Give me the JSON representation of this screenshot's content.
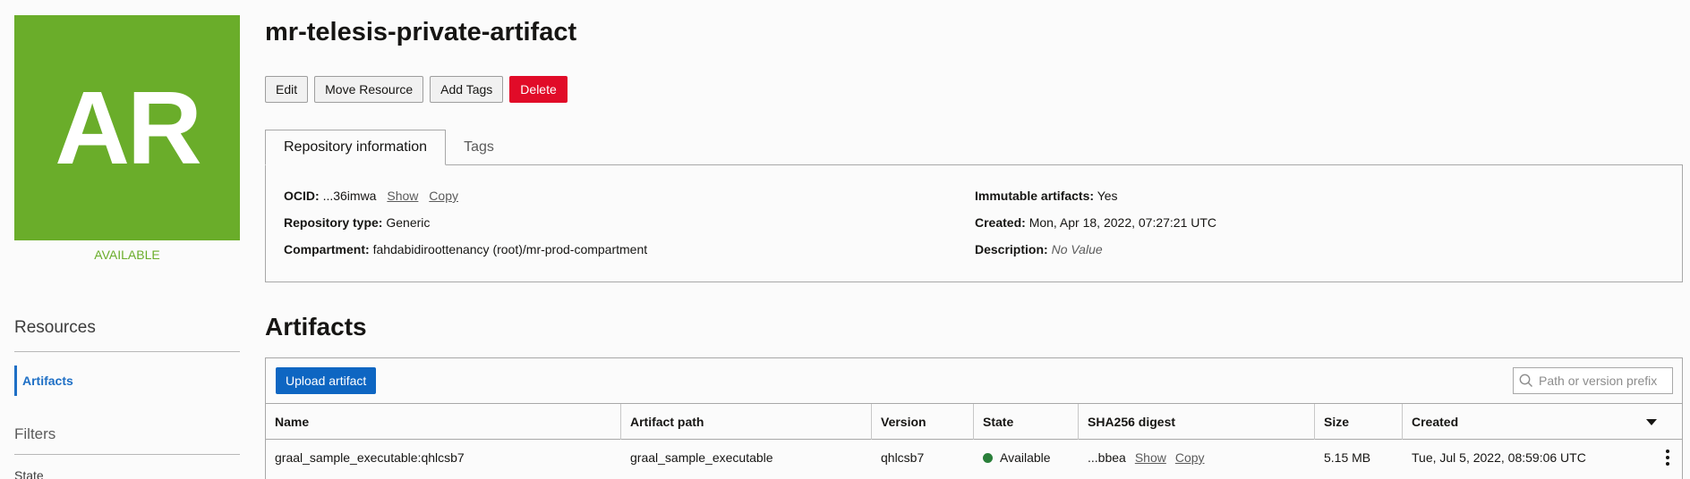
{
  "resource": {
    "initials": "AR",
    "status": "AVAILABLE",
    "title": "mr-telesis-private-artifact"
  },
  "colors": {
    "badge": "#6aad2a",
    "link": "#1e6fc5",
    "danger": "#e10b28",
    "primary": "#0e66c2",
    "status_ok": "#2a7f3a"
  },
  "actions": {
    "edit": "Edit",
    "move": "Move Resource",
    "add_tags": "Add Tags",
    "delete": "Delete"
  },
  "tabs": {
    "repo_info": "Repository information",
    "tags": "Tags"
  },
  "info": {
    "ocid_label": "OCID:",
    "ocid_value": "...36imwa",
    "show": "Show",
    "copy": "Copy",
    "repo_type_label": "Repository type:",
    "repo_type_value": "Generic",
    "compartment_label": "Compartment:",
    "compartment_value": "fahdabidiroottenancy (root)/mr-prod-compartment",
    "immutable_label": "Immutable artifacts:",
    "immutable_value": "Yes",
    "created_label": "Created:",
    "created_value": "Mon, Apr 18, 2022, 07:27:21 UTC",
    "description_label": "Description:",
    "description_value": "No Value"
  },
  "sidebar": {
    "resources_title": "Resources",
    "artifacts": "Artifacts",
    "filters_title": "Filters",
    "state_label": "State"
  },
  "artifacts": {
    "section_title": "Artifacts",
    "upload_label": "Upload artifact",
    "search_placeholder": "Path or version prefix",
    "columns": {
      "name": "Name",
      "path": "Artifact path",
      "version": "Version",
      "state": "State",
      "digest": "SHA256 digest",
      "size": "Size",
      "created": "Created"
    },
    "rows": [
      {
        "name": "graal_sample_executable:qhlcsb7",
        "path": "graal_sample_executable",
        "version": "qhlcsb7",
        "state": "Available",
        "digest": "...bbea",
        "show": "Show",
        "copy": "Copy",
        "size": "5.15 MB",
        "created": "Tue, Jul 5, 2022, 08:59:06 UTC"
      }
    ]
  }
}
